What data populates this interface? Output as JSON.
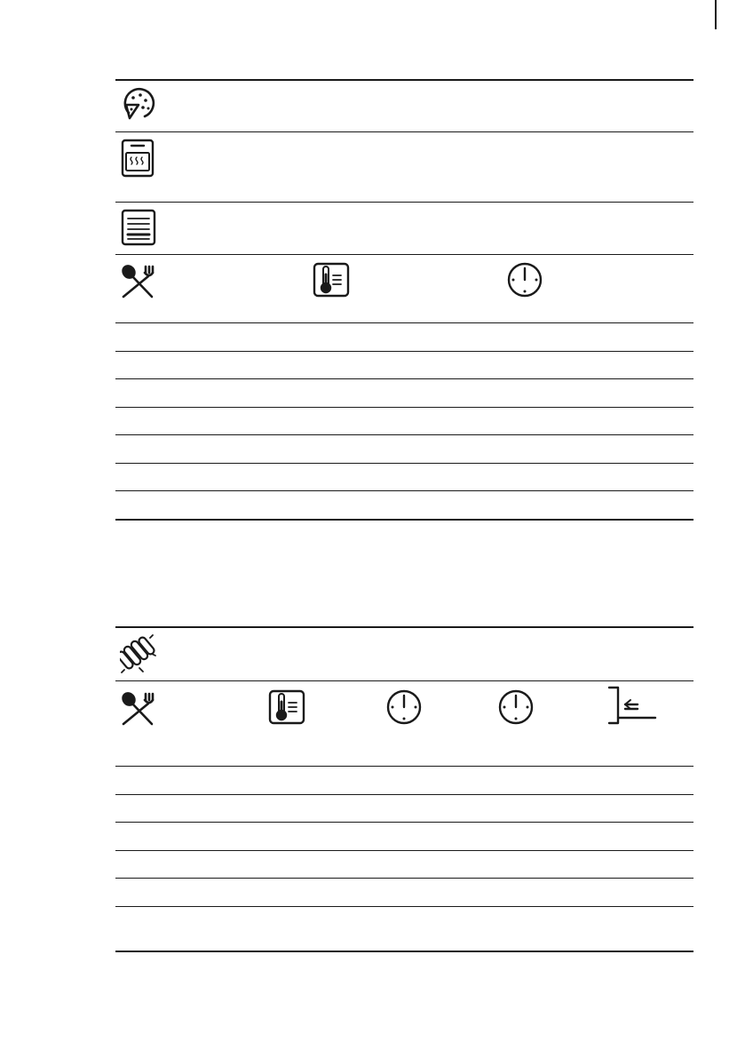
{
  "icons": {
    "table1": [
      "pizza-slice-icon",
      "oven-heat-icon",
      "shelf-level-icon",
      "cutlery-icon",
      "thermometer-icon",
      "clock-icon"
    ],
    "table2": [
      "sausages-icon",
      "cutlery-icon",
      "thermometer-icon",
      "clock-icon",
      "clock-icon",
      "shelf-position-icon"
    ]
  },
  "colors": {
    "ink": "#1a1a1a",
    "background": "#ffffff"
  }
}
